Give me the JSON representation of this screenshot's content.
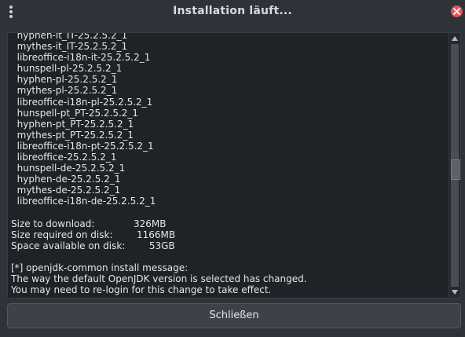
{
  "window": {
    "title": "Installation läuft..."
  },
  "log": {
    "lines": [
      "  hyphen-it_IT-25.2.5.2_1",
      "  mythes-it_IT-25.2.5.2_1",
      "  libreoffice-i18n-it-25.2.5.2_1",
      "  hunspell-pl-25.2.5.2_1",
      "  hyphen-pl-25.2.5.2_1",
      "  mythes-pl-25.2.5.2_1",
      "  libreoffice-i18n-pl-25.2.5.2_1",
      "  hunspell-pt_PT-25.2.5.2_1",
      "  hyphen-pt_PT-25.2.5.2_1",
      "  mythes-pt_PT-25.2.5.2_1",
      "  libreoffice-i18n-pt-25.2.5.2_1",
      "  libreoffice-25.2.5.2_1",
      "  hunspell-de-25.2.5.2_1",
      "  hyphen-de-25.2.5.2_1",
      "  mythes-de-25.2.5.2_1",
      "  libreoffice-i18n-de-25.2.5.2_1",
      "",
      "Size to download:             326MB",
      "Size required on disk:        1166MB",
      "Space available on disk:        53GB",
      "",
      "[*] openjdk-common install message:",
      "The way the default OpenJDK version is selected has changed.",
      "You may need to re-login for this change to take effect."
    ]
  },
  "scroll": {
    "position_fraction": 0.52
  },
  "footer": {
    "close_label": "Schließen"
  },
  "colors": {
    "close_circle": "#e0555b",
    "log_background": "#1f2226",
    "window_background": "#2f3238"
  },
  "icons": {
    "menu": "vertical-dots-icon",
    "close": "close-icon",
    "scroll_up": "triangle-up-icon",
    "scroll_down": "triangle-down-icon"
  }
}
